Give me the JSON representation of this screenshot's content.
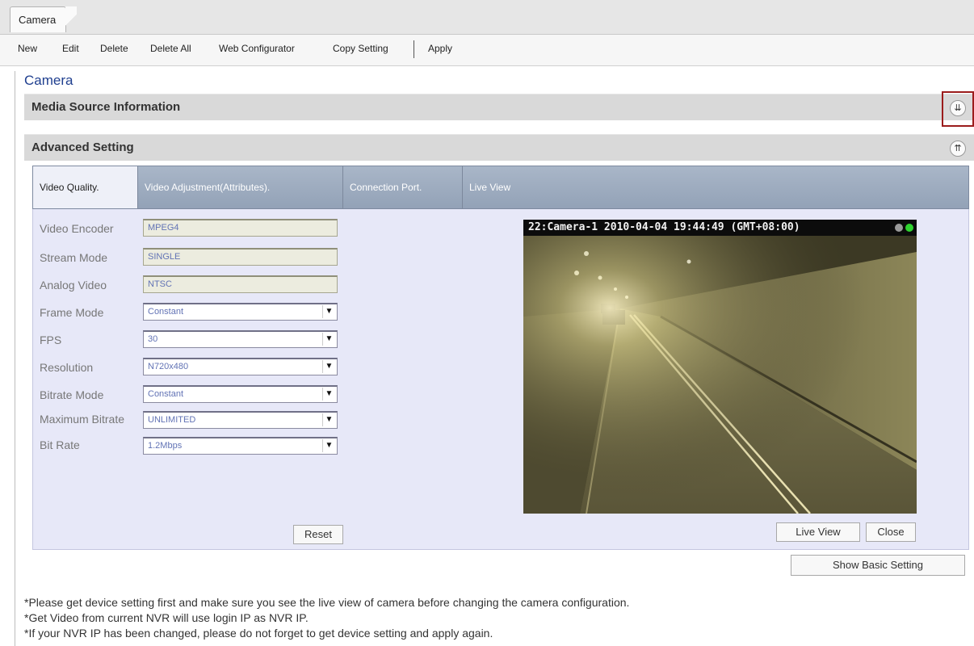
{
  "window_tab": "Camera",
  "toolbar": {
    "new": "New",
    "edit": "Edit",
    "delete": "Delete",
    "delete_all": "Delete All",
    "web_configurator": "Web Configurator",
    "copy_setting": "Copy Setting",
    "apply": "Apply"
  },
  "page_title": "Camera",
  "sections": {
    "media_source": "Media Source Information",
    "advanced": "Advanced Setting"
  },
  "tabs": [
    {
      "label": "Video Quality."
    },
    {
      "label": "Video Adjustment(Attributes)."
    },
    {
      "label": "Connection Port."
    },
    {
      "label": "Live View"
    }
  ],
  "fields": {
    "video_encoder": {
      "label": "Video Encoder",
      "value": "MPEG4"
    },
    "stream_mode": {
      "label": "Stream Mode",
      "value": "SINGLE"
    },
    "analog_video": {
      "label": "Analog Video",
      "value": "NTSC"
    },
    "frame_mode": {
      "label": "Frame Mode",
      "value": "Constant"
    },
    "fps": {
      "label": "FPS",
      "value": "30"
    },
    "resolution": {
      "label": "Resolution",
      "value": "N720x480"
    },
    "bitrate_mode": {
      "label": "Bitrate Mode",
      "value": "Constant"
    },
    "max_bitrate": {
      "label": "Maximum Bitrate",
      "value": "UNLIMITED"
    },
    "bit_rate": {
      "label": "Bit Rate",
      "value": "1.2Mbps"
    }
  },
  "buttons": {
    "reset": "Reset",
    "live_view": "Live View",
    "close": "Close",
    "show_basic": "Show Basic Setting"
  },
  "camera": {
    "overlay": "22:Camera-1  2010-04-04 19:44:49 (GMT+08:00)"
  },
  "notes": [
    "*Please get device setting first and make sure you see the live view of camera before changing the camera configuration.",
    "*Get Video from current NVR will use login IP as NVR IP.",
    "*If your NVR IP has been changed, please do not forget to get device setting and apply again."
  ],
  "colors": {
    "title_blue": "#1f3f8f",
    "tab_bar": "#9aa8bc",
    "panel_bg": "#e7e8f8",
    "highlight_red": "#9b1c1c"
  }
}
